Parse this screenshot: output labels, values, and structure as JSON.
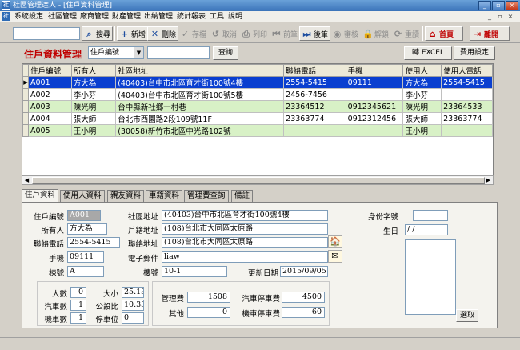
{
  "window": {
    "title": "社區管理達人 - [住戶資料管理]",
    "app_icon": "社"
  },
  "menu": [
    "系統設定",
    "社區管理",
    "廠商管理",
    "財產管理",
    "出納管理",
    "統計報表",
    "工具",
    "說明"
  ],
  "mdi_controls": [
    "_",
    "▫",
    "×"
  ],
  "toolbar": {
    "search_value": "",
    "search": "搜尋",
    "add": "新增",
    "delete": "刪除",
    "save": "存檔",
    "cancel": "取消",
    "print": "列印",
    "prev": "前筆",
    "next": "後筆",
    "review": "審核",
    "unlock": "解鎖",
    "retry": "重讀",
    "home": "首頁",
    "leave": "離開"
  },
  "page_title": "住戶資料管理",
  "filter": {
    "field": "住戶編號",
    "value": "",
    "query": "查詢"
  },
  "export_excel": "轉 EXCEL",
  "fee_settings": "費用設定",
  "grid": {
    "columns": [
      "住戶編號",
      "所有人",
      "社區地址",
      "聯絡電話",
      "手機",
      "使用人",
      "使用人電話"
    ],
    "rows": [
      [
        "A001",
        "方大為",
        "(40403)台中市北區育才街100號4樓",
        "2554-5415",
        "09111",
        "方大為",
        "2554-5415"
      ],
      [
        "A002",
        "李小芬",
        "(40403)台中市北區育才街100號5樓",
        "2456-7456",
        "",
        "李小芬",
        ""
      ],
      [
        "A003",
        "陳光明",
        "台中縣新社鄉一村巷",
        "23364512",
        "0912345621",
        "陳光明",
        "23364533"
      ],
      [
        "A004",
        "張大師",
        "台北市西園路2段109號11F",
        "23363774",
        "0912312456",
        "張大師",
        "23363774"
      ],
      [
        "A005",
        "王小明",
        "(30058)新竹市北區中光路102號",
        "",
        "",
        "王小明",
        ""
      ]
    ]
  },
  "tabs": [
    "住戶資料",
    "使用人資料",
    "親友資料",
    "車籍資料",
    "管理費查詢",
    "備註"
  ],
  "detail": {
    "labels": {
      "id": "住戶編號",
      "owner": "所有人",
      "phone": "聯絡電話",
      "mobile": "手機",
      "building": "棟號",
      "community_addr": "社區地址",
      "household_addr": "戶籍地址",
      "contact_addr": "聯絡地址",
      "email": "電子郵件",
      "floor": "樓號",
      "updated": "更新日期",
      "id_no": "身份字號",
      "birthday": "生日",
      "people": "人數",
      "cars": "汽車數",
      "motorcycles": "機車數",
      "size": "大小",
      "ratio": "公設比",
      "parking": "停車位",
      "mgmt_fee": "管理費",
      "other": "其他",
      "car_fee": "汽車停車費",
      "moto_fee": "機車停車費"
    },
    "values": {
      "id": "A001",
      "owner": "方大為",
      "phone": "2554-5415",
      "mobile": "09111",
      "building": "A",
      "community_addr": "(40403)台中市北區育才街100號4樓",
      "household_addr": "(108)台北市大同區太原路",
      "contact_addr": "(108)台北市大同區太原路",
      "email": "liaw",
      "floor": "10-1",
      "updated": "2015/09/05",
      "id_no": "",
      "birthday": " / /",
      "people": "0",
      "cars": "1",
      "motorcycles": "1",
      "size": "25.13",
      "ratio": "10.33",
      "parking": "0",
      "mgmt_fee": "1508",
      "other": "0",
      "car_fee": "4500",
      "moto_fee": "60"
    },
    "browse": "選取"
  }
}
